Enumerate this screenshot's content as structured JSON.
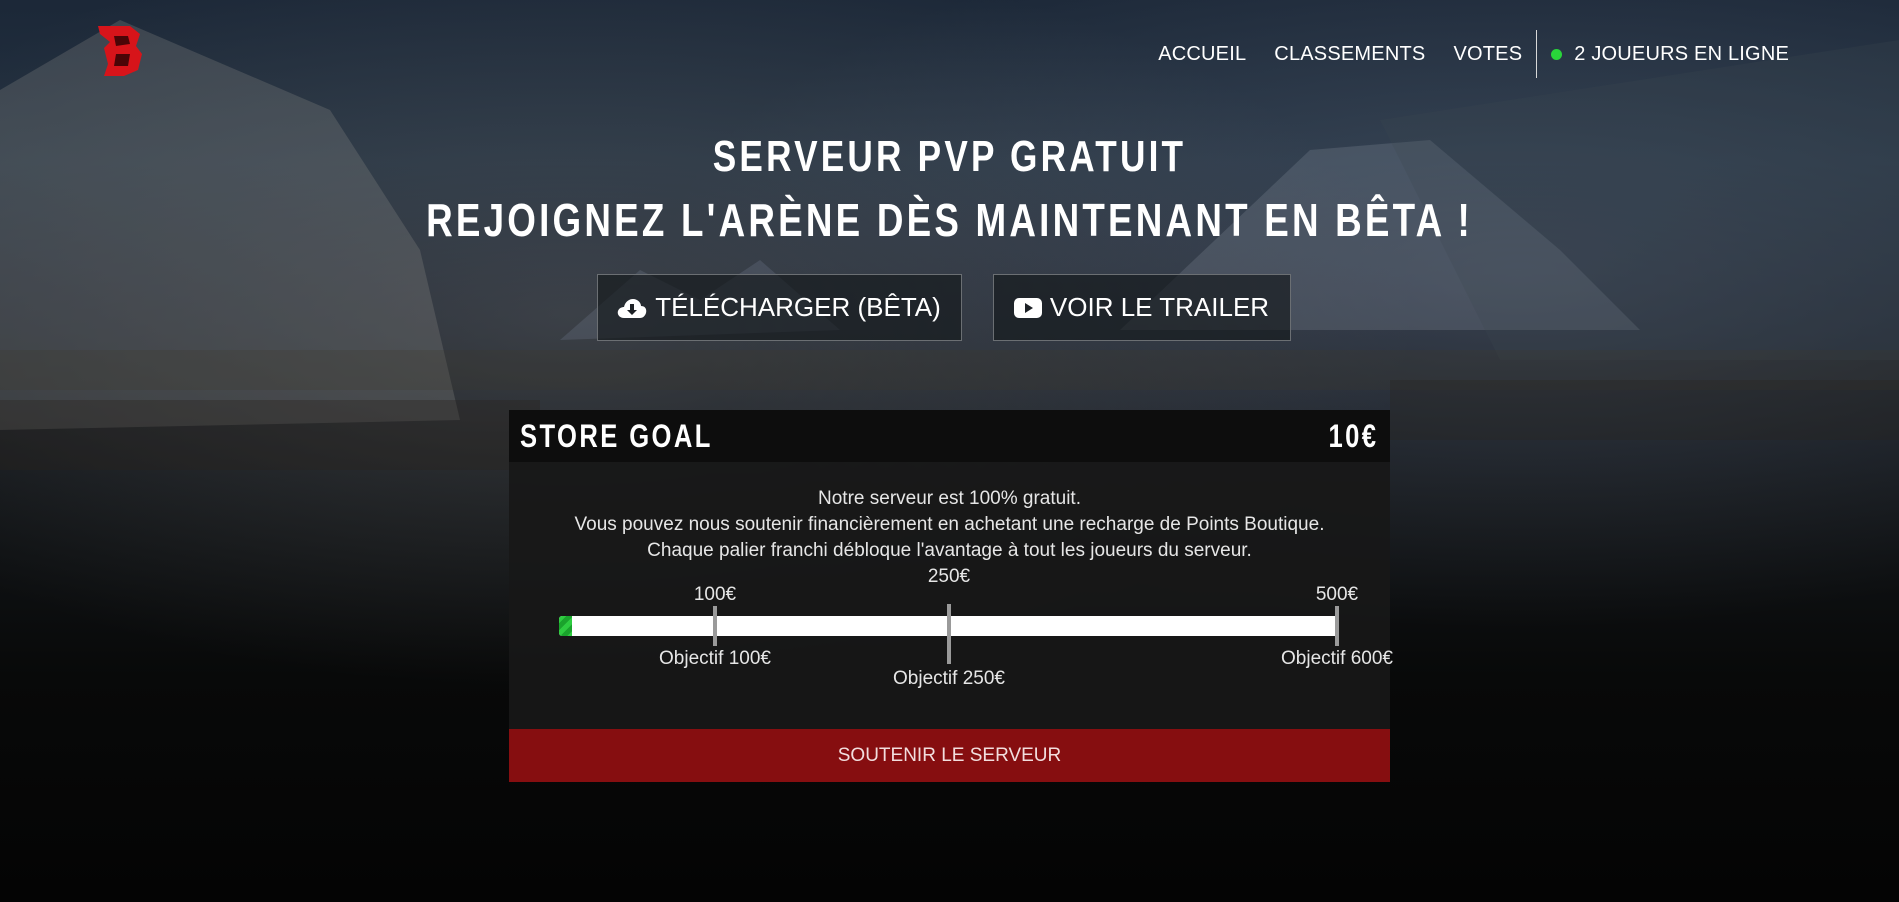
{
  "nav": {
    "items": [
      {
        "label": "ACCUEIL"
      },
      {
        "label": "CLASSEMENTS"
      },
      {
        "label": "VOTES"
      }
    ],
    "online": "2 JOUEURS EN LIGNE",
    "online_color": "#29d43a"
  },
  "logo": {
    "letter": "B",
    "color": "#d7141a"
  },
  "hero": {
    "line1": "SERVEUR PVP GRATUIT",
    "line2": "REJOIGNEZ L'ARÈNE DÈS MAINTENANT EN BÊTA !"
  },
  "buttons": {
    "download": {
      "label": "TÉLÉCHARGER (BÊTA)",
      "icon": "cloud-download-icon"
    },
    "trailer": {
      "label": "VOIR LE TRAILER",
      "icon": "youtube-icon"
    }
  },
  "goal": {
    "title": "STORE GOAL",
    "amount": "10€",
    "text": [
      "Notre serveur est 100% gratuit.",
      "Vous pouvez nous soutenir financièrement en achetant une recharge de Points Boutique.",
      "Chaque palier franchi débloque l'avantage à tout les joueurs du serveur."
    ],
    "progress_fraction": 0.017,
    "milestones": [
      {
        "top": "100€",
        "bottom": "Objectif 100€",
        "fraction": 0.2
      },
      {
        "top": "250€",
        "bottom": "Objectif 250€",
        "fraction": 0.5
      },
      {
        "top": "500€",
        "bottom": "Objectif 600€",
        "fraction": 1.0
      }
    ],
    "button": "SOUTENIR LE SERVEUR",
    "button_color": "#860e10"
  }
}
